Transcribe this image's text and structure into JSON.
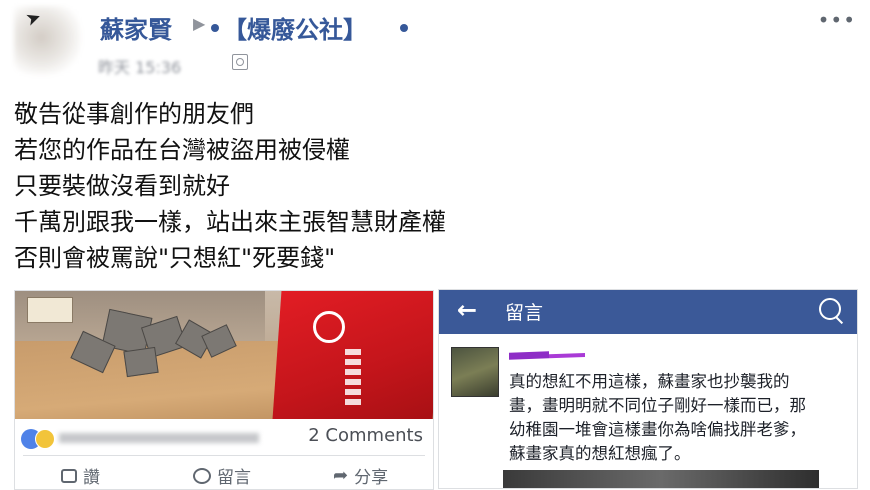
{
  "post": {
    "author": "蘇家賢",
    "group": "【爆廢公社】",
    "time": "昨天 15:36",
    "lines": [
      "敬告從事創作的朋友們",
      "若您的作品在台灣被盜用被侵權",
      "只要裝做沒看到就好",
      "千萬別跟我一樣，站出來主張智慧財產權",
      "否則會被罵說\"只想紅\"死要錢\""
    ]
  },
  "shared_card": {
    "comments": "2 Comments",
    "actions": {
      "like": "讚",
      "comment": "留言",
      "share": "分享"
    }
  },
  "comment_panel": {
    "title": "留言",
    "comment_lines": [
      "真的想紅不用這樣，蘇畫家也抄襲我的",
      "畫，畫明明就不同位子剛好一樣而已，那",
      "幼稚園一堆會這樣畫你為啥偏找胖老爹，",
      "蘇畫家真的想紅想瘋了。"
    ]
  },
  "colors": {
    "link": "#365899",
    "fb_blue": "#3b5998",
    "muted": "#606770"
  }
}
